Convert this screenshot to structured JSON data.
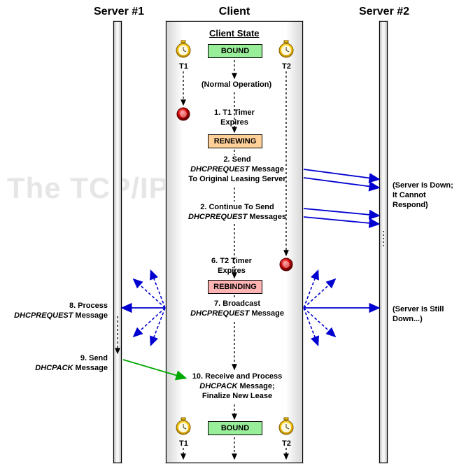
{
  "headers": {
    "server1": "Server #1",
    "client": "Client",
    "server2": "Server #2"
  },
  "watermark": "The TCP/IP Guide",
  "stateTitle": "Client State",
  "states": {
    "bound1": {
      "label": "BOUND",
      "bg": "#99ee99"
    },
    "renewing": {
      "label": "RENEWING",
      "bg": "#ffd199"
    },
    "rebinding": {
      "label": "REBINDING",
      "bg": "#ffb3b3"
    },
    "bound2": {
      "label": "BOUND",
      "bg": "#99ee99"
    }
  },
  "timers": {
    "t1": "T1",
    "t2": "T2"
  },
  "steps": {
    "normal": "(Normal Operation)",
    "s1": "1. T1 Timer\nExpires",
    "s2": "2. Send\nDHCPREQUEST Message\nTo Original Leasing Server",
    "s2b": "2. Continue To Send\nDHCPREQUEST Messages",
    "s6": "6. T2 Timer\nExpires",
    "s7": "7. Broadcast\nDHCPREQUEST Message",
    "s8": "8. Process\nDHCPREQUEST Message",
    "s9": "9. Send\nDHCPACK Message",
    "s10": "10. Receive and Process\nDHCPACK Message;\nFinalize New Lease"
  },
  "notes": {
    "down": "(Server Is Down;\nIt Cannot Respond)",
    "stillDown": "(Server Is Still Down...)"
  }
}
